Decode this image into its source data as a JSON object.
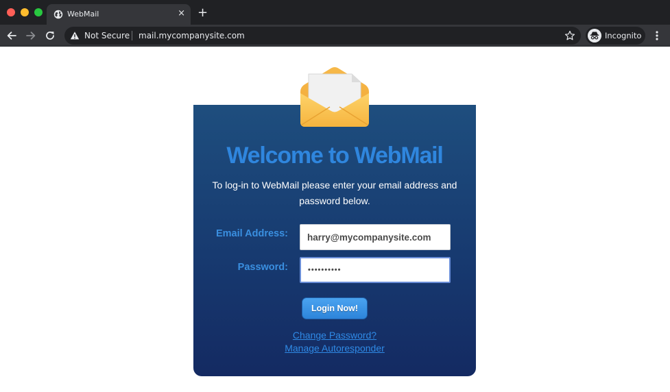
{
  "browser": {
    "tab": {
      "title": "WebMail",
      "close_glyph": "×",
      "favicon": "globe-icon"
    },
    "new_tab_glyph": "+",
    "omnibox": {
      "security_label": "Not Secure",
      "security_icon": "warning-icon",
      "url": "mail.mycompanysite.com",
      "bookmark_icon": "star-icon"
    },
    "profile": {
      "label": "Incognito",
      "icon": "incognito-icon"
    },
    "menu_icon": "more-vertical-icon"
  },
  "page": {
    "logo_icon": "open-envelope-icon",
    "title": "Welcome to WebMail",
    "intro": "To log-in to WebMail please enter your email address and password below.",
    "form": {
      "email_label": "Email Address:",
      "email_value": "harry@mycompanysite.com",
      "password_label": "Password:",
      "password_value": "••••••••••",
      "submit_label": "Login Now!"
    },
    "links": {
      "change_password": "Change Password?",
      "manage_autoresponder": "Manage Autoresponder"
    }
  },
  "colors": {
    "title": "#2f86de",
    "card_top": "#1e4e7e",
    "card_bottom": "#142a62",
    "label": "#3a8fe0",
    "button": "#3a93e6",
    "link": "#2f8ae6"
  }
}
